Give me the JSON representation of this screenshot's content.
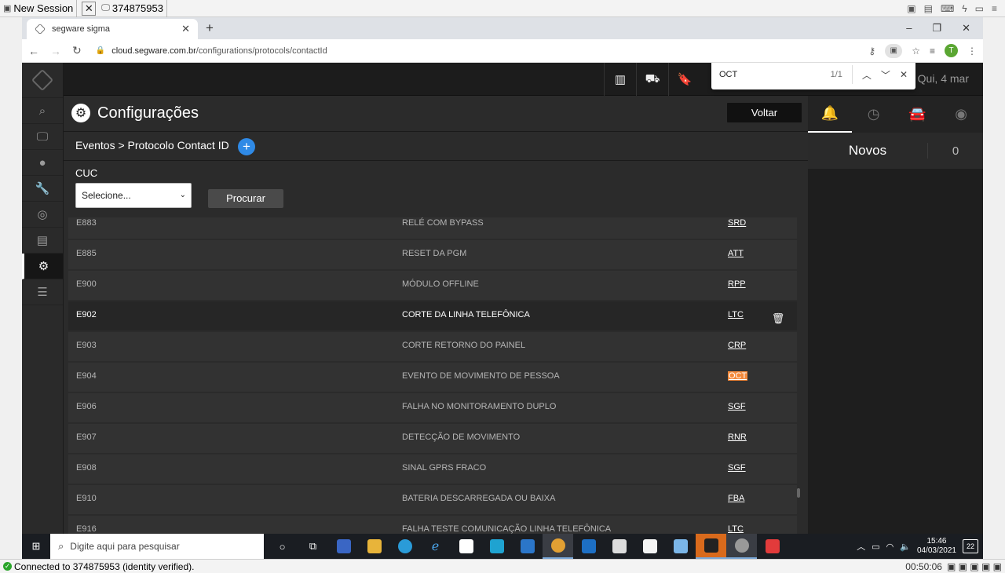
{
  "remote_session": {
    "tab1": "New Session",
    "tab2": "374875953",
    "status": "Connected to 374875953 (identity verified).",
    "elapsed": "00:50:06"
  },
  "browser": {
    "tab_title": "segware sigma",
    "url_domain": "cloud.segware.com.br",
    "url_path": "/configurations/protocols/contactId",
    "avatar_letter": "T"
  },
  "find": {
    "query": "OCT",
    "count": "1/1"
  },
  "topbar": {
    "date": "Qui, 4 mar"
  },
  "config": {
    "title": "Configurações",
    "back_label": "Voltar",
    "breadcrumb": "Eventos > Protocolo Contact ID",
    "add_label": "+",
    "cuc_label": "CUC",
    "select_value": "Selecione...",
    "search_label": "Procurar"
  },
  "rows": [
    {
      "code": "E883",
      "desc": "RELÉ COM BYPASS",
      "tag": "SRD"
    },
    {
      "code": "E885",
      "desc": "RESET DA PGM",
      "tag": "ATT"
    },
    {
      "code": "E900",
      "desc": "MÓDULO OFFLINE",
      "tag": "RPP"
    },
    {
      "code": "E902",
      "desc": "CORTE DA LINHA TELEFÔNICA",
      "tag": "LTC"
    },
    {
      "code": "E903",
      "desc": "CORTE RETORNO DO PAINEL",
      "tag": "CRP"
    },
    {
      "code": "E904",
      "desc": "EVENTO DE MOVIMENTO DE PESSOA",
      "tag": "OCT"
    },
    {
      "code": "E906",
      "desc": "FALHA NO MONITORAMENTO DUPLO",
      "tag": "SGF"
    },
    {
      "code": "E907",
      "desc": "DETECÇÃO DE MOVIMENTO",
      "tag": "RNR"
    },
    {
      "code": "E908",
      "desc": "SINAL GPRS FRACO",
      "tag": "SGF"
    },
    {
      "code": "E910",
      "desc": "BATERIA DESCARREGADA OU BAIXA",
      "tag": "FBA"
    },
    {
      "code": "E916",
      "desc": "FALHA TESTE COMUNICAÇÃO LINHA TELEFÔNICA",
      "tag": "LTC"
    }
  ],
  "right_panel": {
    "label": "Novos",
    "count": "0"
  },
  "taskbar": {
    "search_placeholder": "Digite aqui para pesquisar",
    "time": "15:46",
    "date": "04/03/2021",
    "notifications": "22"
  }
}
